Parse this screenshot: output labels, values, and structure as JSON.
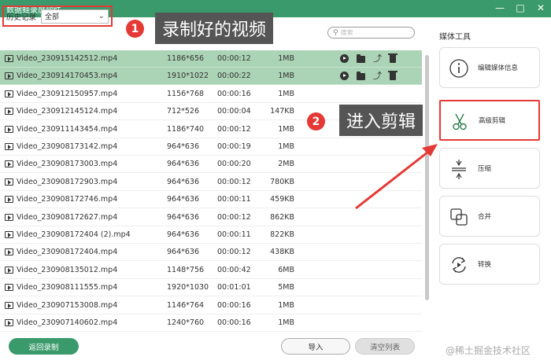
{
  "window": {
    "title": "数据蛙录屏软件"
  },
  "toolbar": {
    "history_label": "历史记录",
    "filter_value": "全部",
    "search_placeholder": "搜索"
  },
  "annotations": {
    "step1_number": "1",
    "step1_text": "录制好的视频",
    "step2_number": "2",
    "step2_text": "进入剪辑",
    "color": "#e53935"
  },
  "files": [
    {
      "name": "Video_230915142512.mp4",
      "resolution": "1186*656",
      "duration": "00:00:12",
      "size": "1MB",
      "selected": true
    },
    {
      "name": "Video_230914170453.mp4",
      "resolution": "1910*1022",
      "duration": "00:00:22",
      "size": "1MB",
      "selected": true
    },
    {
      "name": "Video_230912150957.mp4",
      "resolution": "1156*768",
      "duration": "00:00:16",
      "size": "1MB",
      "selected": false
    },
    {
      "name": "Video_230912145124.mp4",
      "resolution": "712*526",
      "duration": "00:00:04",
      "size": "147KB",
      "selected": false
    },
    {
      "name": "Video_230911143454.mp4",
      "resolution": "1186*740",
      "duration": "00:00:12",
      "size": "1MB",
      "selected": false
    },
    {
      "name": "Video_230908173142.mp4",
      "resolution": "964*636",
      "duration": "00:00:19",
      "size": "1MB",
      "selected": false
    },
    {
      "name": "Video_230908173003.mp4",
      "resolution": "964*636",
      "duration": "00:00:20",
      "size": "2MB",
      "selected": false
    },
    {
      "name": "Video_230908172903.mp4",
      "resolution": "964*636",
      "duration": "00:00:12",
      "size": "780KB",
      "selected": false
    },
    {
      "name": "Video_230908172746.mp4",
      "resolution": "964*636",
      "duration": "00:00:11",
      "size": "459KB",
      "selected": false
    },
    {
      "name": "Video_230908172627.mp4",
      "resolution": "964*636",
      "duration": "00:00:12",
      "size": "862KB",
      "selected": false
    },
    {
      "name": "Video_230908172404 (2).mp4",
      "resolution": "964*636",
      "duration": "00:00:11",
      "size": "822KB",
      "selected": false
    },
    {
      "name": "Video_230908172404.mp4",
      "resolution": "964*636",
      "duration": "00:00:12",
      "size": "438KB",
      "selected": false
    },
    {
      "name": "Video_230908135012.mp4",
      "resolution": "1148*756",
      "duration": "00:00:42",
      "size": "6MB",
      "selected": false
    },
    {
      "name": "Video_230908111555.mp4",
      "resolution": "1920*1030",
      "duration": "00:01:01",
      "size": "5MB",
      "selected": false
    },
    {
      "name": "Video_230907153008.mp4",
      "resolution": "1146*764",
      "duration": "00:00:16",
      "size": "1MB",
      "selected": false
    },
    {
      "name": "Video_230907140602.mp4",
      "resolution": "1240*760",
      "duration": "00:00:16",
      "size": "1MB",
      "selected": false
    }
  ],
  "sidebar": {
    "title": "媒体工具",
    "tools": [
      {
        "label": "编辑媒体信息",
        "icon": "info-icon"
      },
      {
        "label": "高级剪辑",
        "icon": "scissors-icon"
      },
      {
        "label": "压缩",
        "icon": "compress-icon"
      },
      {
        "label": "合并",
        "icon": "merge-icon"
      },
      {
        "label": "转换",
        "icon": "convert-icon"
      }
    ]
  },
  "bottom": {
    "back_label": "返回录制",
    "import_label": "导入",
    "clear_label": "清空列表"
  },
  "watermark": "@稀土掘金技术社区",
  "colors": {
    "brand": "#3b9a6c",
    "selected_row": "#abd3b6",
    "highlight": "#e53935"
  }
}
